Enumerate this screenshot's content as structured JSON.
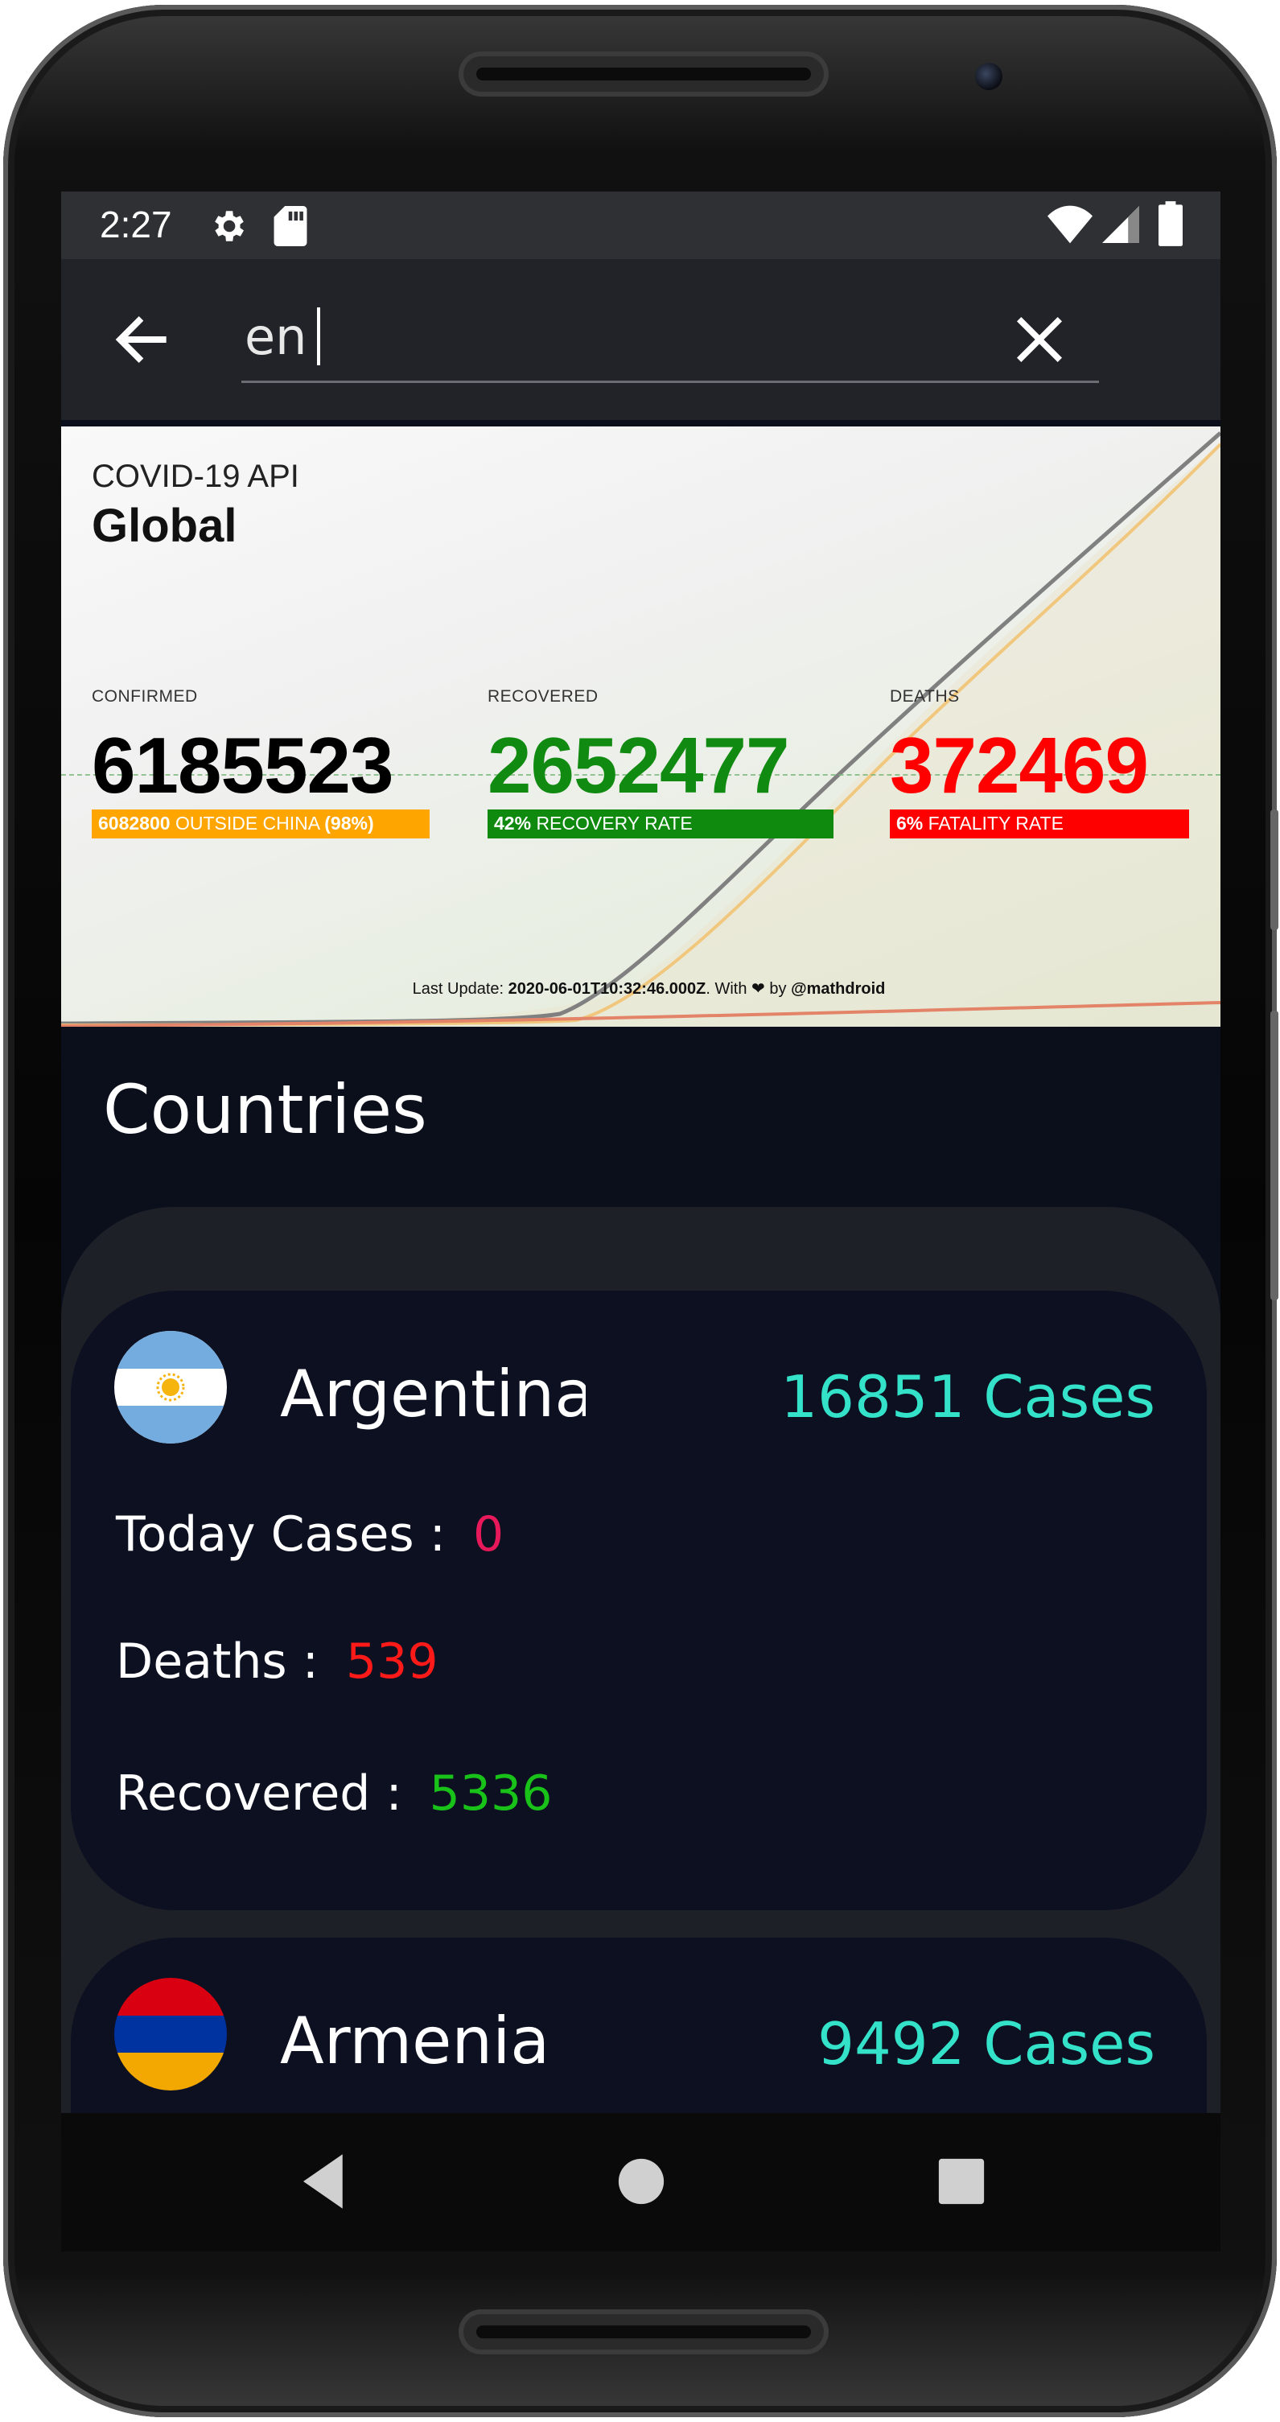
{
  "status_bar": {
    "time": "2:27"
  },
  "search": {
    "query": "en"
  },
  "banner": {
    "subtitle": "COVID-19 API",
    "title": "Global",
    "confirmed": {
      "label": "CONFIRMED",
      "value": "6185523",
      "bar_number": "6082800",
      "bar_text": "OUTSIDE CHINA",
      "bar_pct": "(98%)",
      "color": "#000000",
      "bar_color": "#ffa500"
    },
    "recovered": {
      "label": "RECOVERED",
      "value": "2652477",
      "bar_number": "42%",
      "bar_text": "RECOVERY RATE",
      "color": "#108a10",
      "bar_color": "#0f8a0f"
    },
    "deaths": {
      "label": "DEATHS",
      "value": "372469",
      "bar_number": "6%",
      "bar_text": "FATALITY RATE",
      "color": "#ff0000",
      "bar_color": "#ff0000"
    },
    "footer": {
      "prefix": "Last Update:",
      "timestamp": "2020-06-01T10:32:46.000Z",
      "with": ". With",
      "heart": "❤",
      "by": "by",
      "author": "@mathdroid"
    }
  },
  "section_title": "Countries",
  "countries": [
    {
      "name": "Argentina",
      "cases": "16851 Cases",
      "today_cases_label": "Today Cases :",
      "today_cases": "0",
      "deaths_label": "Deaths :",
      "deaths": "539",
      "recovered_label": "Recovered :",
      "recovered": "5336"
    },
    {
      "name": "Armenia",
      "cases": "9492 Cases"
    }
  ],
  "colors": {
    "accent_cases": "#33e2c9",
    "today_cases": "#e8195a",
    "deaths": "#ff1a1a",
    "recovered": "#19c219"
  },
  "icons": [
    "gear-icon",
    "sd-card-icon",
    "wifi-icon",
    "signal-icon",
    "battery-icon",
    "back-arrow-icon",
    "close-icon",
    "nav-back-icon",
    "nav-home-icon",
    "nav-recents-icon"
  ]
}
